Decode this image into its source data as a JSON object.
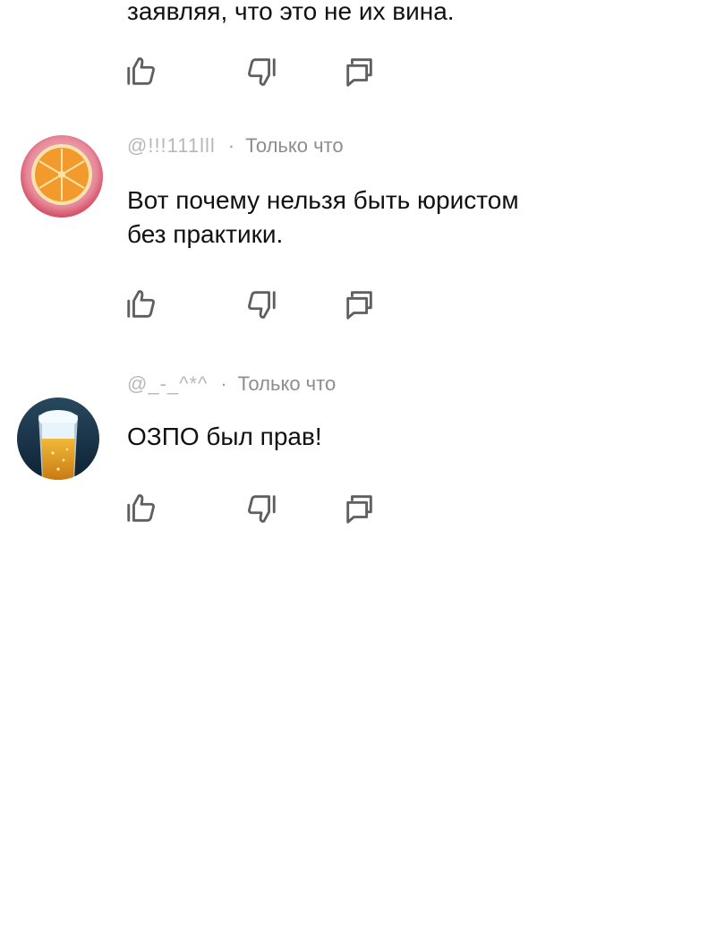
{
  "comments": [
    {
      "text_lines": [
        "заявляя, что это не их вина."
      ]
    },
    {
      "author": "@!!!111lll",
      "time": "Только что",
      "text_lines": [
        "Вот почему нельзя быть юристом",
        "без практики."
      ]
    },
    {
      "author": "@_-_^*^",
      "time": "Только что",
      "text_lines": [
        "ОЗПО был прав!"
      ]
    }
  ],
  "icons": {
    "like": "thumb-up-icon",
    "dislike": "thumb-down-icon",
    "reply": "reply-icon"
  },
  "colors": {
    "text": "#111111",
    "meta": "#9e9e9e",
    "icon": "#5f5f5f"
  }
}
